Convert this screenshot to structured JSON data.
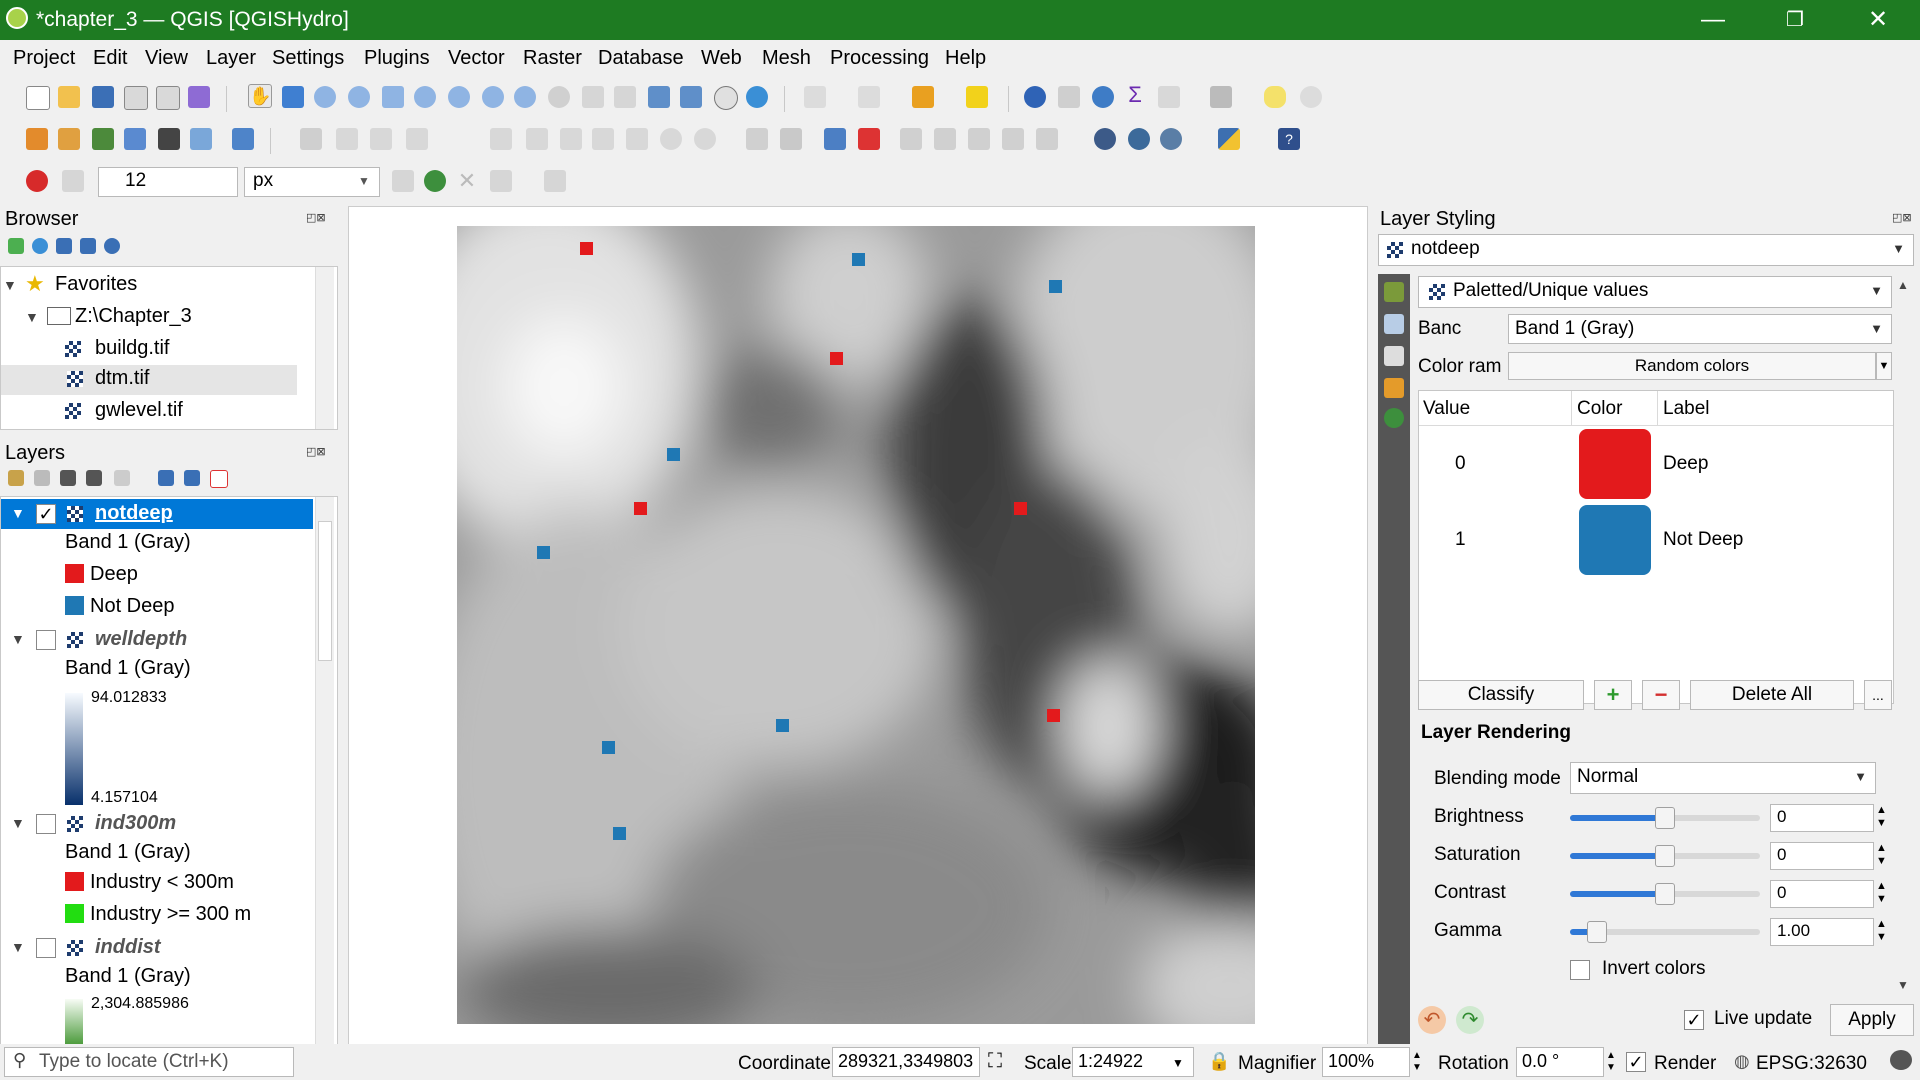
{
  "window": {
    "title": "*chapter_3 — QGIS [QGISHydro]",
    "minimize": "—",
    "restore": "❐",
    "close": "✕"
  },
  "menu": [
    "Project",
    "Edit",
    "View",
    "Layer",
    "Settings",
    "Plugins",
    "Vector",
    "Raster",
    "Database",
    "Web",
    "Mesh",
    "Processing",
    "Help"
  ],
  "toolbar3": {
    "size_value": "12",
    "unit_value": "px"
  },
  "browser": {
    "title": "Browser",
    "items": [
      {
        "label": "Favorites"
      },
      {
        "label": "Z:\\Chapter_3"
      },
      {
        "label": "buildg.tif"
      },
      {
        "label": "dtm.tif"
      },
      {
        "label": "gwlevel.tif"
      }
    ]
  },
  "layers": {
    "title": "Layers",
    "notdeep": {
      "name": "notdeep",
      "band": "Band 1 (Gray)",
      "classes": [
        {
          "label": "Deep",
          "color": "#e31a1c"
        },
        {
          "label": "Not Deep",
          "color": "#1f78b4"
        }
      ]
    },
    "welldepth": {
      "name": "welldepth",
      "band": "Band 1 (Gray)",
      "max": "94.012833",
      "min": "4.157104"
    },
    "ind300m": {
      "name": "ind300m",
      "band": "Band 1 (Gray)",
      "classes": [
        {
          "label": "Industry < 300m",
          "color": "#e31a1c"
        },
        {
          "label": "Industry >= 300 m",
          "color": "#22dd11"
        }
      ]
    },
    "inddist": {
      "name": "inddist",
      "band": "Band 1 (Gray)",
      "max": "2,304.885986"
    }
  },
  "styling": {
    "title": "Layer Styling",
    "layer": "notdeep",
    "renderer": "Paletted/Unique values",
    "band_label": "Banc",
    "band_value": "Band 1 (Gray)",
    "ramp_label": "Color ram",
    "ramp_value": "Random colors",
    "table_headers": [
      "Value",
      "Color",
      "Label"
    ],
    "table_rows": [
      {
        "value": "0",
        "color": "#e31a1c",
        "label": "Deep"
      },
      {
        "value": "1",
        "color": "#1f78b4",
        "label": "Not Deep"
      }
    ],
    "classify": "Classify",
    "delete_all": "Delete All",
    "more": "...",
    "rendering_title": "Layer Rendering",
    "blending_label": "Blending mode",
    "blending_value": "Normal",
    "brightness_label": "Brightness",
    "brightness_value": "0",
    "brightness_level": 0.5,
    "saturation_label": "Saturation",
    "saturation_value": "0",
    "saturation_level": 0.5,
    "contrast_label": "Contrast",
    "contrast_value": "0",
    "contrast_level": 0.5,
    "gamma_label": "Gamma",
    "gamma_value": "1.00",
    "gamma_level": 0.14,
    "invert_label": "Invert colors",
    "live_update_label": "Live update",
    "apply": "Apply"
  },
  "status": {
    "locate_placeholder": "Type to locate (Ctrl+K)",
    "coordinate_label": "Coordinate",
    "coordinate_value": "289321,3349803",
    "scale_label": "Scale",
    "scale_value": "1:24922",
    "magnifier_label": "Magnifier",
    "magnifier_value": "100%",
    "rotation_label": "Rotation",
    "rotation_value": "0.0 °",
    "render_label": "Render",
    "crs": "EPSG:32630"
  }
}
